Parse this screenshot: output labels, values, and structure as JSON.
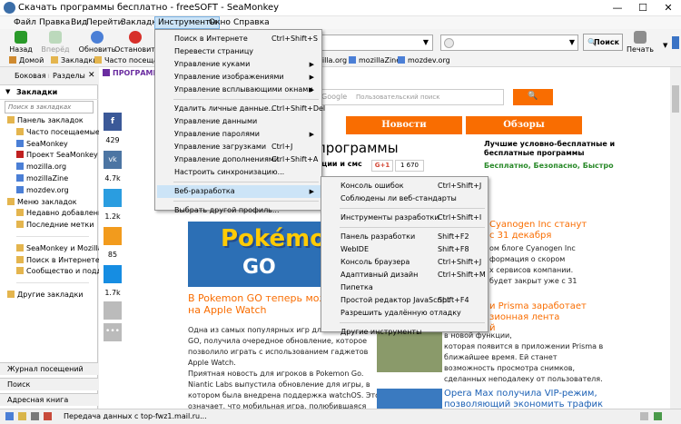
{
  "window": {
    "title": "Скачать программы бесплатно - freeSOFT - SeaMonkey",
    "minimize": "—",
    "maximize": "☐",
    "close": "✕"
  },
  "menubar": [
    "Файл",
    "Правка",
    "Вид",
    "Перейти",
    "Закладки",
    "Инструменты",
    "Окно",
    "Справка"
  ],
  "nav": {
    "back": "Назад",
    "forward": "Вперёд",
    "reload": "Обновить",
    "stop": "Остановить",
    "search": "Поиск",
    "print": "Печать"
  },
  "bookmarks_toolbar": [
    "Домой",
    "Закладки",
    "Часто посещаемые",
    "mozilla.org",
    "mozillaZine",
    "mozdev.org"
  ],
  "sidebar": {
    "title": "Боковая панель",
    "sections": "Разделы",
    "header": "Закладки",
    "search_placeholder": "Поиск в закладках",
    "tree": [
      {
        "label": "Панель закладок",
        "indent": 0,
        "icon": "folder"
      },
      {
        "label": "Часто посещаемые",
        "indent": 1,
        "icon": "folder"
      },
      {
        "label": "SeaMonkey",
        "indent": 1,
        "icon": "page"
      },
      {
        "label": "Проект SeaMonkey",
        "indent": 1,
        "icon": "red"
      },
      {
        "label": "mozilla.org",
        "indent": 1,
        "icon": "page"
      },
      {
        "label": "mozillaZine",
        "indent": 1,
        "icon": "page"
      },
      {
        "label": "mozdev.org",
        "indent": 1,
        "icon": "page"
      },
      {
        "label": "Меню закладок",
        "indent": 0,
        "icon": "folder"
      },
      {
        "label": "Недавно добавленные",
        "indent": 1,
        "icon": "folder"
      },
      {
        "label": "Последние метки",
        "indent": 1,
        "icon": "folder"
      },
      {
        "label": "",
        "indent": 1,
        "icon": ""
      },
      {
        "label": "SeaMonkey и Mozilla",
        "indent": 1,
        "icon": "folder"
      },
      {
        "label": "Поиск в Интернете",
        "indent": 1,
        "icon": "folder"
      },
      {
        "label": "Сообщество и поддержка",
        "indent": 1,
        "icon": "folder"
      },
      {
        "label": "",
        "indent": 1,
        "icon": ""
      },
      {
        "label": "Другие закладки",
        "indent": 0,
        "icon": "folder"
      }
    ],
    "footer": [
      "Журнал посещений",
      "Поиск",
      "Адресная книга"
    ]
  },
  "tools_menu": [
    {
      "label": "Поиск в Интернете",
      "shortcut": "Ctrl+Shift+S"
    },
    {
      "label": "Перевести страницу",
      "shortcut": ""
    },
    {
      "label": "Управление куками",
      "shortcut": "",
      "sub": true
    },
    {
      "label": "Управление изображениями",
      "shortcut": "",
      "sub": true
    },
    {
      "label": "Управление всплывающими окнами",
      "shortcut": "",
      "sub": true
    },
    {
      "sep": true
    },
    {
      "label": "Удалить личные данные...",
      "shortcut": "Ctrl+Shift+Del"
    },
    {
      "label": "Управление данными",
      "shortcut": ""
    },
    {
      "label": "Управление паролями",
      "shortcut": "",
      "sub": true
    },
    {
      "label": "Управление загрузками",
      "shortcut": "Ctrl+J"
    },
    {
      "label": "Управление дополнениями",
      "shortcut": "Ctrl+Shift+A"
    },
    {
      "label": "Настроить синхронизацию...",
      "shortcut": ""
    },
    {
      "sep": true
    },
    {
      "label": "Веб-разработка",
      "shortcut": "",
      "sub": true,
      "hl": true
    },
    {
      "sep": true
    },
    {
      "label": "Выбрать другой профиль...",
      "shortcut": ""
    }
  ],
  "webdev_menu": [
    {
      "label": "Консоль ошибок",
      "shortcut": "Ctrl+Shift+J"
    },
    {
      "label": "Соблюдены ли веб-стандарты",
      "shortcut": ""
    },
    {
      "sep": true
    },
    {
      "label": "Инструменты разработки",
      "shortcut": "Ctrl+Shift+I"
    },
    {
      "sep": true
    },
    {
      "label": "Панель разработки",
      "shortcut": "Shift+F2"
    },
    {
      "label": "WebIDE",
      "shortcut": "Shift+F8"
    },
    {
      "label": "Консоль браузера",
      "shortcut": "Ctrl+Shift+J"
    },
    {
      "label": "Адаптивный дизайн",
      "shortcut": "Ctrl+Shift+M"
    },
    {
      "label": "Пипетка",
      "shortcut": ""
    },
    {
      "label": "Простой редактор JavaScript",
      "shortcut": "Shift+F4"
    },
    {
      "label": "Разрешить удалённую отладку",
      "shortcut": ""
    },
    {
      "sep": true
    },
    {
      "label": "Другие инструменты",
      "shortcut": ""
    }
  ],
  "page": {
    "programs_link": "ПРОГРАММ",
    "search_placeholder": "Пользовательский поиск",
    "google": "Google",
    "tabs": [
      "Новости",
      "Обзоры"
    ],
    "heading": "программы",
    "subheading": "ации и смс",
    "gplus": "G+1",
    "gcount": "1 670",
    "promo_title": "Лучшие условно-бесплатные и бесплатные программы",
    "promo_sub": "Бесплатно, Безопасно, Быстро",
    "share_counts": [
      "429",
      "4.7k",
      "1.2k",
      "85",
      "1.7k"
    ],
    "news1_title": "Cyanogen Inc станут",
    "news1_title2": "с 31 декабря",
    "news1_text": [
      "ом блоге Cyanogen Inc",
      "формация о скором",
      "х сервисов компании.",
      "будет закрыт уже с 31"
    ],
    "news2_title": "и Prisma заработает",
    "news2_title2": "зионная лента",
    "news2_title3": "й",
    "news2_text": [
      "в новой функции,",
      "которая появится в приложении Prisma в",
      "ближайшее время. Ей станет",
      "возможность просмотра снимков,",
      "сделанных неподалеку от пользователя."
    ],
    "news3_title": "Opera Max получила VIP-режим,",
    "news3_title2": "позволяющий экономить трафик",
    "pokemon_logo": "Pokémon",
    "pokemon_go": "GO",
    "article_title": "В Pokemon GO теперь можно",
    "article_title2": "на Apple Watch",
    "article_text": [
      "Одна из самых популярных игр для iOS - Pokemon",
      "GO, получила очередное обновление, которое",
      "позволило играть с использованием гаджетов",
      "Apple Watch.",
      "Приятная новость для игроков в Pokemon Go.",
      "Niantic Labs выпустила обновление для игры, в",
      "котором была внедрена поддержка watchOS. Это",
      "означает, что мобильная игра, полюбившаяся"
    ]
  },
  "status": {
    "text": "Передача данных с top-fwz1.mail.ru..."
  }
}
